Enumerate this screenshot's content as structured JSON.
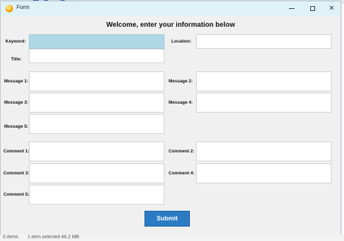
{
  "window": {
    "title": "Form",
    "heading": "Welcome, enter your information below"
  },
  "fields": {
    "keyword": {
      "label": "Keyword:",
      "value": ""
    },
    "location": {
      "label": "Location:",
      "value": ""
    },
    "title": {
      "label": "Title:",
      "value": ""
    },
    "message1": {
      "label": "Message 1:",
      "value": ""
    },
    "message2": {
      "label": "Message 2:",
      "value": ""
    },
    "message3": {
      "label": "Message 3:",
      "value": ""
    },
    "message4": {
      "label": "Message 4:",
      "value": ""
    },
    "message5": {
      "label": "Message 5:",
      "value": ""
    },
    "comment1": {
      "label": "Comment 1:",
      "value": ""
    },
    "comment2": {
      "label": "Comment 2:",
      "value": ""
    },
    "comment3": {
      "label": "Comment 3:",
      "value": ""
    },
    "comment4": {
      "label": "Comment 4:",
      "value": ""
    },
    "comment5": {
      "label": "Comment 5:",
      "value": ""
    }
  },
  "submit_label": "Submit",
  "background": {
    "status_items": "0 items",
    "status_selected": "1 item selected  46.2 MB"
  },
  "colors": {
    "focused_field": "#add8e6",
    "submit_button": "#2a7bc4",
    "titlebar": "#dff3f7"
  }
}
